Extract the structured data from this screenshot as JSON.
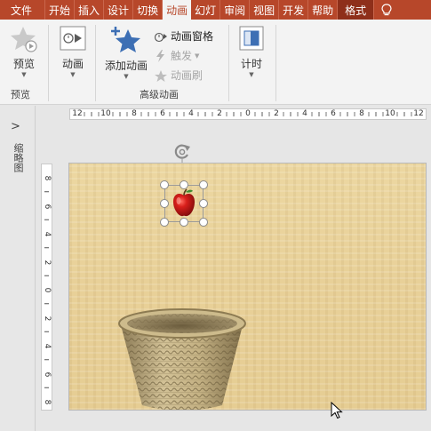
{
  "tabs": [
    {
      "label": "文件"
    },
    {
      "label": "开始"
    },
    {
      "label": "插入"
    },
    {
      "label": "设计"
    },
    {
      "label": "切换"
    },
    {
      "label": "动画"
    },
    {
      "label": "幻灯"
    },
    {
      "label": "审阅"
    },
    {
      "label": "视图"
    },
    {
      "label": "开发"
    },
    {
      "label": "帮助"
    },
    {
      "label": "格式"
    }
  ],
  "ribbon": {
    "preview_label": "预览",
    "preview_group": "预览",
    "animation_label": "动画",
    "add_animation_label": "添加动画",
    "animation_pane_label": "动画窗格",
    "trigger_label": "触发",
    "animation_painter_label": "动画刷",
    "advanced_group": "高级动画",
    "timing_label": "计时"
  },
  "left_panel": {
    "thumbnail_label": "缩略图"
  },
  "rulers": {
    "horizontal_ticks": [
      "12",
      "10",
      "8",
      "6",
      "4",
      "2",
      "0",
      "2",
      "4",
      "6",
      "8",
      "10",
      "12"
    ],
    "vertical_ticks": [
      "8",
      "6",
      "4",
      "2",
      "0",
      "2",
      "4",
      "6",
      "8"
    ]
  },
  "colors": {
    "ribbon_accent": "#b7472a",
    "slide_background": "#e8d098"
  }
}
